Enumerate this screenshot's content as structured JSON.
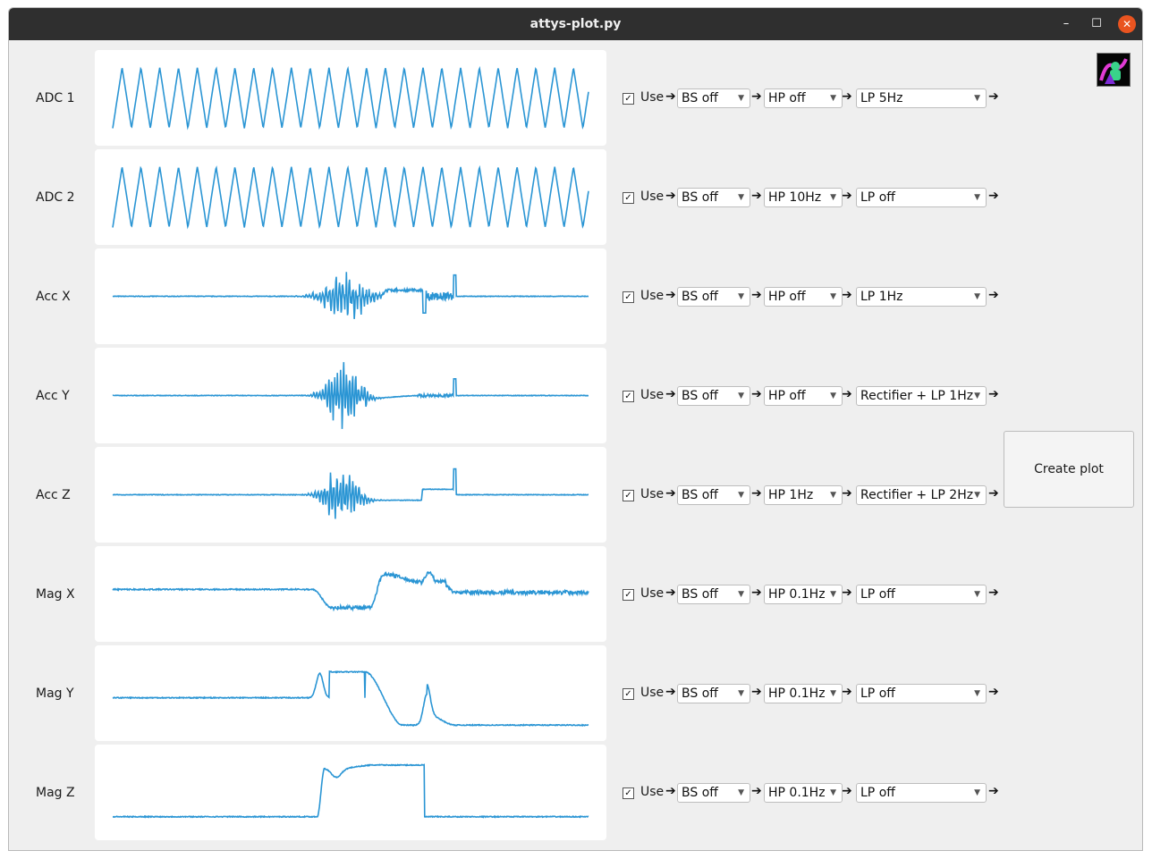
{
  "window": {
    "title": "attys-plot.py",
    "min_glyph": "–",
    "max_glyph": "☐",
    "close_glyph": "✕"
  },
  "logo_icon": "attys-logo-icon",
  "trace_color": "#2a95d4",
  "create_button_label": "Create plot",
  "use_label": "Use",
  "arrow_glyph": "➔",
  "caret_glyph": "▼",
  "check_glyph": "✓",
  "rows": [
    {
      "label": "ADC 1",
      "use": true,
      "bs": "BS off",
      "hp": "HP off",
      "lp": "LP 5Hz",
      "signal": "triangle"
    },
    {
      "label": "ADC 2",
      "use": true,
      "bs": "BS off",
      "hp": "HP 10Hz",
      "lp": "LP off",
      "signal": "triangle"
    },
    {
      "label": "Acc X",
      "use": true,
      "bs": "BS off",
      "hp": "HP off",
      "lp": "LP 1Hz",
      "signal": "accx"
    },
    {
      "label": "Acc Y",
      "use": true,
      "bs": "BS off",
      "hp": "HP off",
      "lp": "Rectifier + LP 1Hz",
      "signal": "accy"
    },
    {
      "label": "Acc Z",
      "use": true,
      "bs": "BS off",
      "hp": "HP 1Hz",
      "lp": "Rectifier + LP 2Hz",
      "signal": "accz"
    },
    {
      "label": "Mag X",
      "use": true,
      "bs": "BS off",
      "hp": "HP 0.1Hz",
      "lp": "LP off",
      "signal": "magx"
    },
    {
      "label": "Mag Y",
      "use": true,
      "bs": "BS off",
      "hp": "HP 0.1Hz",
      "lp": "LP off",
      "signal": "magy"
    },
    {
      "label": "Mag Z",
      "use": true,
      "bs": "BS off",
      "hp": "HP 0.1Hz",
      "lp": "LP off",
      "signal": "magz"
    }
  ]
}
